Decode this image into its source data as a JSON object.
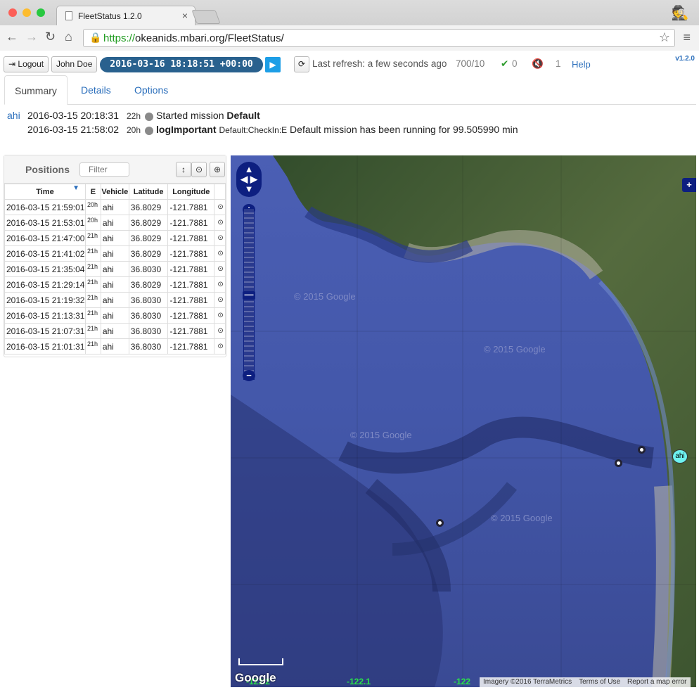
{
  "browser": {
    "tab_title": "FleetStatus 1.2.0",
    "url_scheme": "https://",
    "url_rest": "okeanids.mbari.org/FleetStatus/"
  },
  "appbar": {
    "logout_label": "Logout",
    "user_label": "John Doe",
    "datetime": "2016-03-16 18:18:51 +00:00",
    "last_refresh": "Last refresh: a few seconds ago",
    "count": "700/10",
    "ok_count": "0",
    "mute_count": "1",
    "help_label": "Help",
    "version": "v1.2.0"
  },
  "tabs": [
    "Summary",
    "Details",
    "Options"
  ],
  "log": [
    {
      "vehicle": "ahi",
      "date": "2016-03-15 20:18:31",
      "ago": "22h",
      "msg_pre": "Started mission ",
      "msg_bold": "Default",
      "msg_rest": ""
    },
    {
      "vehicle": "",
      "date": "2016-03-15 21:58:02",
      "ago": "20h",
      "msg_pre": "",
      "msg_bold": "logImportant",
      "msg_small": "Default:CheckIn:E",
      "msg_rest": " Default mission has been running for 99.505990 min"
    }
  ],
  "positions": {
    "title": "Positions",
    "filter_placeholder": "Filter",
    "columns": [
      "Time",
      "E",
      "Vehicle",
      "Latitude",
      "Longitude"
    ],
    "rows": [
      [
        "2016-03-15 21:59:01",
        "20h",
        "ahi",
        "36.8029",
        "-121.7881"
      ],
      [
        "2016-03-15 21:53:01",
        "20h",
        "ahi",
        "36.8029",
        "-121.7881"
      ],
      [
        "2016-03-15 21:47:00",
        "21h",
        "ahi",
        "36.8029",
        "-121.7881"
      ],
      [
        "2016-03-15 21:41:02",
        "21h",
        "ahi",
        "36.8029",
        "-121.7881"
      ],
      [
        "2016-03-15 21:35:04",
        "21h",
        "ahi",
        "36.8030",
        "-121.7881"
      ],
      [
        "2016-03-15 21:29:14",
        "21h",
        "ahi",
        "36.8029",
        "-121.7881"
      ],
      [
        "2016-03-15 21:19:32",
        "21h",
        "ahi",
        "36.8030",
        "-121.7881"
      ],
      [
        "2016-03-15 21:13:31",
        "21h",
        "ahi",
        "36.8030",
        "-121.7881"
      ],
      [
        "2016-03-15 21:07:31",
        "21h",
        "ahi",
        "36.8030",
        "-121.7881"
      ],
      [
        "2016-03-15 21:01:31",
        "21h",
        "ahi",
        "36.8030",
        "-121.7881"
      ]
    ]
  },
  "map": {
    "lon_labels": [
      "-122.2",
      "-122.1",
      "-122"
    ],
    "watermark": "© 2015 Google",
    "vehicle_label": "ahi",
    "logo": "Google",
    "attribution": [
      "Imagery ©2016 TerraMetrics",
      "Terms of Use",
      "Report a map error"
    ]
  }
}
